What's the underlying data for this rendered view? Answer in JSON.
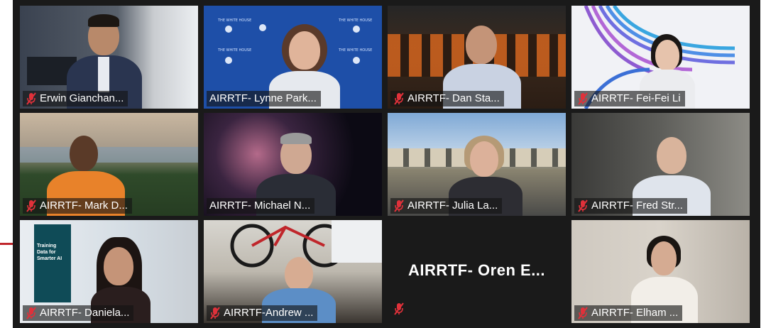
{
  "participants": [
    {
      "name": "Erwin Gianchan..."
    },
    {
      "name": "AIRRTF- Lynne Park..."
    },
    {
      "name": "AIRRTF- Dan Sta..."
    },
    {
      "name": "AIRRTF- Fei-Fei Li"
    },
    {
      "name": "AIRRTF- Mark D..."
    },
    {
      "name": "AIRRTF- Michael N..."
    },
    {
      "name": "AIRRTF- Julia La..."
    },
    {
      "name": "AIRRTF- Fred Str..."
    },
    {
      "name": "AIRRTF- Daniela..."
    },
    {
      "name": "AIRRTF-Andrew ..."
    },
    {
      "name": "AIRRTF- Oren E..."
    },
    {
      "name": "AIRRTF- Elham ..."
    }
  ],
  "backgrounds": {
    "white_house_text": "THE WHITE HOUSE",
    "banner_text": "Training Data for Smarter AI"
  },
  "colors": {
    "active_speaker_outline": "#c6e64a",
    "muted_icon": "#e0313a"
  },
  "icons": {
    "muted": "mic-muted-icon"
  }
}
